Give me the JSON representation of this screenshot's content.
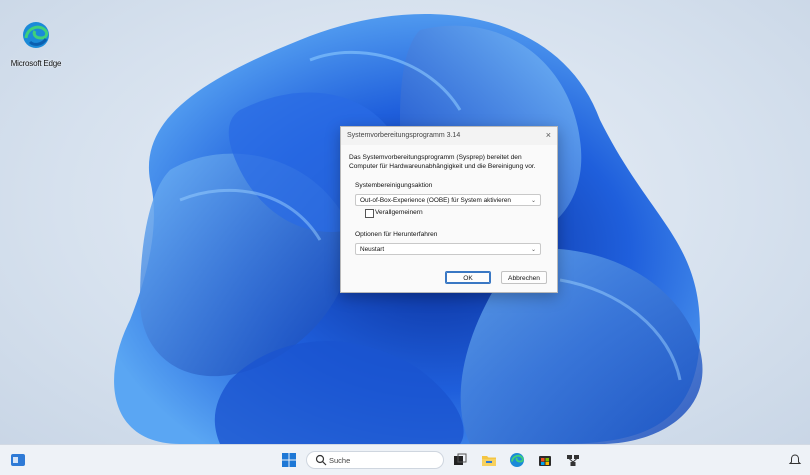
{
  "desktop": {
    "icons": [
      {
        "label": "Microsoft Edge",
        "icon": "edge-icon"
      }
    ]
  },
  "dialog": {
    "title": "Systemvorbereitungsprogramm 3.14",
    "close_glyph": "×",
    "description": "Das Systemvorbereitungsprogramm (Sysprep) bereitet den Computer für Hardwareunabhängigkeit und die Bereinigung vor.",
    "cleanup_group_label": "Systembereinigungsaktion",
    "cleanup_action": "Out-of-Box-Experience (OOBE) für System aktivieren",
    "generalize_label": "Verallgemeinern",
    "generalize_checked": false,
    "shutdown_group_label": "Optionen für Herunterfahren",
    "shutdown_option": "Neustart",
    "ok_label": "OK",
    "cancel_label": "Abbrechen",
    "chevron_glyph": "⌄"
  },
  "taskbar": {
    "search_placeholder": "Suche",
    "items": [
      "widgets-icon",
      "start-icon",
      "search-icon",
      "task-view-icon",
      "file-explorer-icon",
      "edge-icon",
      "store-icon",
      "network-app-icon"
    ]
  },
  "colors": {
    "accent": "#3a78c4",
    "bloom_dark": "#0b3fb8",
    "bloom_light": "#4f9ef0"
  }
}
